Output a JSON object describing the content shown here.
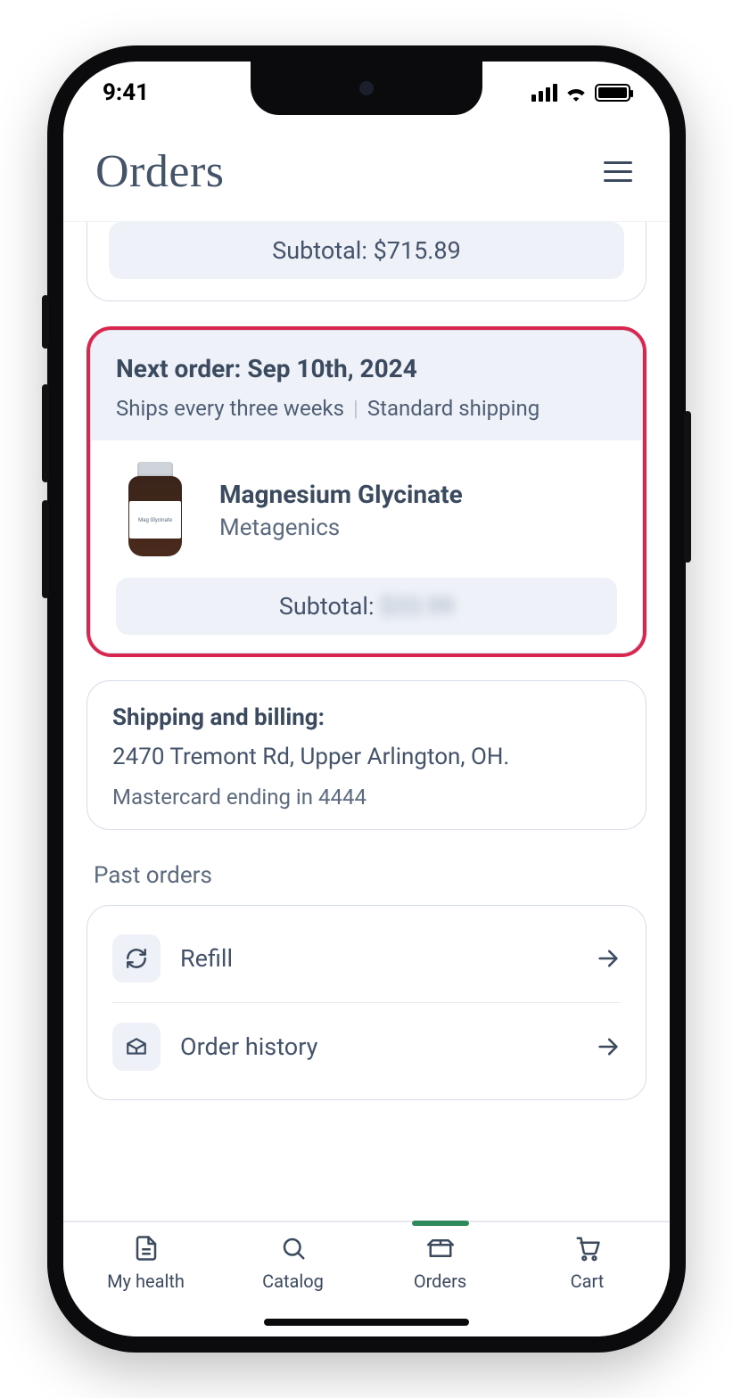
{
  "status": {
    "time": "9:41"
  },
  "header": {
    "title": "Orders"
  },
  "prev_card": {
    "subtotal_label": "Subtotal: ",
    "subtotal_value": "$715.89"
  },
  "next_order": {
    "title": "Next order: Sep 10th, 2024",
    "frequency": "Ships every three weeks",
    "shipping_method": "Standard shipping",
    "product": {
      "name": "Magnesium Glycinate",
      "brand": "Metagenics",
      "bottle_label": "Mag Glycinate"
    },
    "subtotal_label": "Subtotal: ",
    "subtotal_value_blurred": "$33.99"
  },
  "shipping_billing": {
    "title": "Shipping and billing:",
    "address": "2470 Tremont Rd, Upper Arlington, OH.",
    "payment": "Mastercard ending in 4444"
  },
  "past_orders": {
    "section_label": "Past orders",
    "refill_label": "Refill",
    "history_label": "Order history"
  },
  "tabs": {
    "my_health": "My health",
    "catalog": "Catalog",
    "orders": "Orders",
    "cart": "Cart"
  }
}
